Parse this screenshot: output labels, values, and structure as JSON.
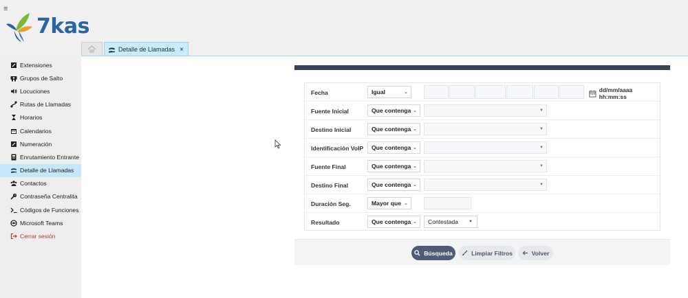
{
  "brand": {
    "name": "7kas",
    "colors": {
      "blue": "#2b64a6",
      "green": "#7db83a",
      "orange": "#e5a22b"
    }
  },
  "header": {
    "menu_icon": "hamburger-icon"
  },
  "tabs": {
    "home_icon": "home-icon",
    "active": {
      "label": "Detalle de Llamadas",
      "icon": "phone-hand-icon",
      "close": "×"
    }
  },
  "sidebar": {
    "items": [
      {
        "label": "Extensiones",
        "icon": "extension-icon"
      },
      {
        "label": "Grupos de Salto",
        "icon": "group-icon"
      },
      {
        "label": "Locuciones",
        "icon": "speaker-icon"
      },
      {
        "label": "Rutas de Llamadas",
        "icon": "route-icon"
      },
      {
        "label": "Horarios",
        "icon": "hourglass-icon"
      },
      {
        "label": "Calendarios",
        "icon": "calendar-icon"
      },
      {
        "label": "Numeración",
        "icon": "numbering-icon"
      },
      {
        "label": "Enrutamiento Entrante",
        "icon": "inbound-icon"
      },
      {
        "label": "Detalle de Llamadas",
        "icon": "phone-hand-icon",
        "active": true
      },
      {
        "label": "Contactos",
        "icon": "contacts-icon"
      },
      {
        "label": "Contraseña Centralita",
        "icon": "key-icon"
      },
      {
        "label": "Códigos de Funciones",
        "icon": "terminal-icon"
      },
      {
        "label": "Microsoft Teams",
        "icon": "teams-icon"
      },
      {
        "label": "Cerrar sesión",
        "icon": "logout-icon"
      }
    ],
    "active_color": "#c4e8fa"
  },
  "filters": {
    "fecha": {
      "label": "Fecha",
      "operator": "Igual",
      "hint": "dd/mm/aaaa hh:mm:ss"
    },
    "fuente_inicial": {
      "label": "Fuente Inicial",
      "operator": "Que contenga"
    },
    "destino_inicial": {
      "label": "Destino Inicial",
      "operator": "Que contenga"
    },
    "identificacion_voip": {
      "label": "Identificación VoIP",
      "operator": "Que contenga"
    },
    "fuente_final": {
      "label": "Fuente Final",
      "operator": "Que contenga"
    },
    "destino_final": {
      "label": "Destino Final",
      "operator": "Que contenga"
    },
    "duracion": {
      "label": "Duración Seg.",
      "operator": "Mayor que"
    },
    "resultado": {
      "label": "Resultado",
      "operator": "Que contenga",
      "value": "Contestada"
    }
  },
  "buttons": {
    "search": "Búsqueda",
    "clear": "Limpiar Filtros",
    "back": "Volver"
  },
  "colors": {
    "panel_header": "#3a4353",
    "primary_button": "#4f5b77"
  }
}
